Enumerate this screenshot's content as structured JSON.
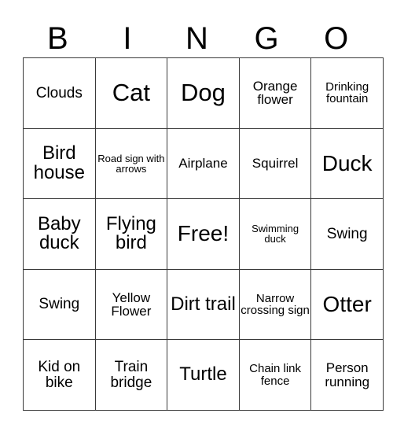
{
  "card": {
    "title_letters": [
      "B",
      "I",
      "N",
      "G",
      "O"
    ],
    "columns": 5,
    "rows": 5,
    "free_space_label": "Free!",
    "grid": [
      [
        {
          "label": "Clouds",
          "size": "sm"
        },
        {
          "label": "Cat",
          "size": "xl"
        },
        {
          "label": "Dog",
          "size": "xl"
        },
        {
          "label": "Orange flower",
          "size": "xs"
        },
        {
          "label": "Drinking fountain",
          "size": "xxs"
        }
      ],
      [
        {
          "label": "Bird house",
          "size": "md"
        },
        {
          "label": "Road sign with arrows",
          "size": "tiny"
        },
        {
          "label": "Airplane",
          "size": "xs"
        },
        {
          "label": "Squirrel",
          "size": "xs"
        },
        {
          "label": "Duck",
          "size": "lg"
        }
      ],
      [
        {
          "label": "Baby duck",
          "size": "md"
        },
        {
          "label": "Flying bird",
          "size": "md"
        },
        {
          "label": "Free!",
          "size": "lg"
        },
        {
          "label": "Swimming duck",
          "size": "tiny"
        },
        {
          "label": "Swing",
          "size": "sm"
        }
      ],
      [
        {
          "label": "Swing",
          "size": "sm"
        },
        {
          "label": "Yellow Flower",
          "size": "xs"
        },
        {
          "label": "Dirt trail",
          "size": "md"
        },
        {
          "label": "Narrow crossing sign",
          "size": "xxs"
        },
        {
          "label": "Otter",
          "size": "lg"
        }
      ],
      [
        {
          "label": "Kid on bike",
          "size": "sm"
        },
        {
          "label": "Train bridge",
          "size": "sm"
        },
        {
          "label": "Turtle",
          "size": "md"
        },
        {
          "label": "Chain link fence",
          "size": "xxs"
        },
        {
          "label": "Person running",
          "size": "xs"
        }
      ]
    ]
  },
  "colors": {
    "border": "#3a3a3a",
    "text": "#000000",
    "background": "#ffffff"
  }
}
